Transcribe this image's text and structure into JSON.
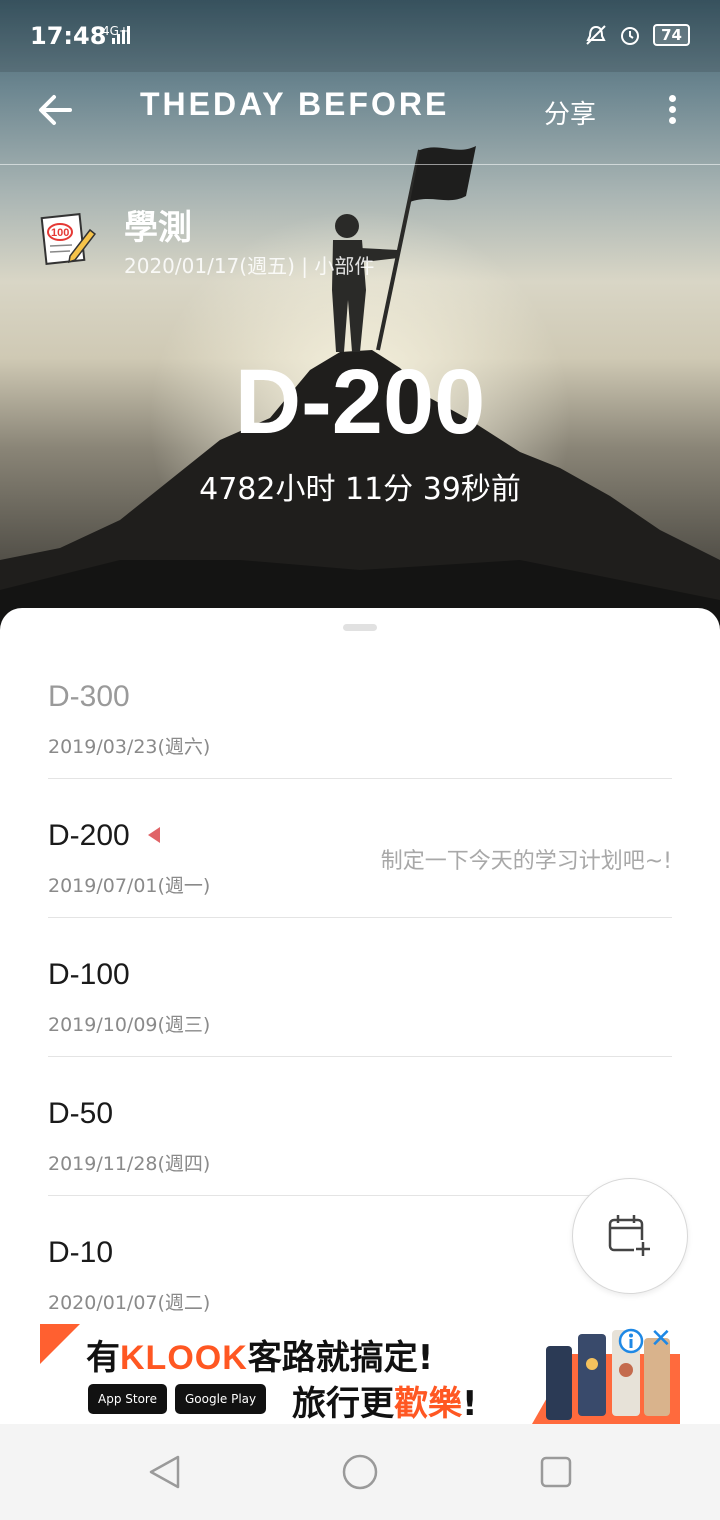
{
  "status_bar": {
    "time": "17:48",
    "network": "4G+",
    "battery": "74"
  },
  "app_bar": {
    "logo": "THEDAY BEFORE",
    "share_label": "分享"
  },
  "event": {
    "title": "學測",
    "subtitle": "2020/01/17(週五) | 小部件",
    "countdown": "D-200",
    "elapsed": "4782小时 11分 39秒前"
  },
  "milestones": [
    {
      "label": "D-300",
      "date": "2019/03/23(週六)",
      "past": true,
      "current": false,
      "note": ""
    },
    {
      "label": "D-200",
      "date": "2019/07/01(週一)",
      "past": false,
      "current": true,
      "note": "制定一下今天的学习计划吧~!"
    },
    {
      "label": "D-100",
      "date": "2019/10/09(週三)",
      "past": false,
      "current": false,
      "note": ""
    },
    {
      "label": "D-50",
      "date": "2019/11/28(週四)",
      "past": false,
      "current": false,
      "note": ""
    },
    {
      "label": "D-10",
      "date": "2020/01/07(週二)",
      "past": false,
      "current": false,
      "note": ""
    }
  ],
  "ad": {
    "line1_prefix": "有",
    "brand": "KLOOK",
    "line1_mid": "客路",
    "line1_suffix": "就搞定!",
    "app_store": "App Store",
    "google_play": "Google Play",
    "line2_prefix": "旅行更",
    "line2_accent": "歡樂",
    "line2_suffix": "!",
    "close": "✕"
  },
  "colors": {
    "accent_marker": "#e06467",
    "ad_brand": "#ff5722",
    "ad_close": "#1e88e5"
  },
  "icons": {
    "back": "back-arrow-icon",
    "more": "more-vertical-icon",
    "event": "exam-paper-pencil-icon",
    "fab": "calendar-add-icon"
  }
}
